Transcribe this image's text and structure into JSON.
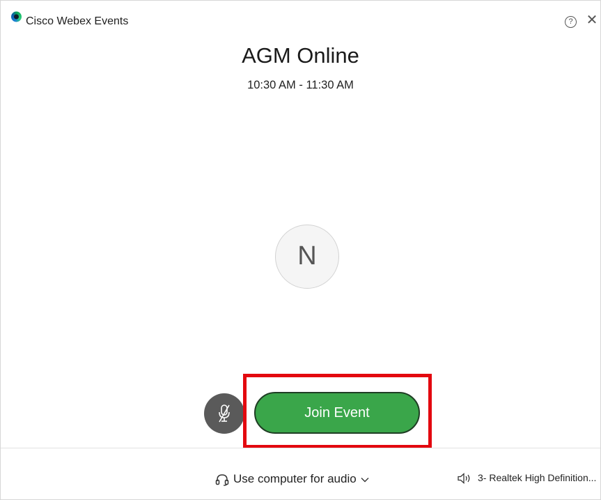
{
  "window": {
    "app_title": "Cisco Webex Events",
    "help_icon": "question-circle-icon",
    "help_glyph": "?",
    "close_icon": "close-icon",
    "close_glyph": "✕"
  },
  "event": {
    "title": "AGM Online",
    "time": "10:30 AM - 11:30 AM"
  },
  "avatar": {
    "initial": "N"
  },
  "controls": {
    "mute_icon": "microphone-muted-icon",
    "join_label": "Join Event",
    "join_color": "#3aa64a",
    "highlight_color": "#e3080f"
  },
  "audio": {
    "connection_label": "Use computer for audio",
    "connection_icon": "headset-icon",
    "dropdown_icon": "chevron-down-icon",
    "speaker_label": "3- Realtek High Definition...",
    "speaker_icon": "speaker-icon"
  }
}
